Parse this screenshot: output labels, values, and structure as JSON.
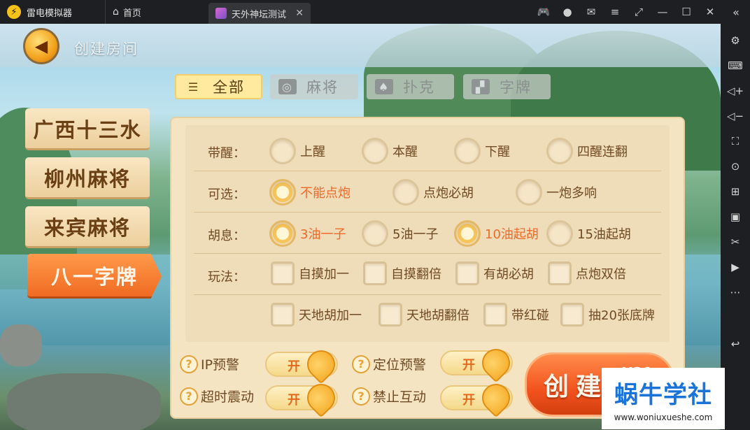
{
  "titlebar": {
    "app_name": "雷电模拟器",
    "tabs": [
      {
        "label": "首页"
      },
      {
        "label": "天外神坛测试"
      }
    ]
  },
  "game": {
    "page_title": "创建房间",
    "categories": [
      {
        "label": "全部",
        "active": true
      },
      {
        "label": "麻将",
        "active": false
      },
      {
        "label": "扑克",
        "active": false
      },
      {
        "label": "字牌",
        "active": false
      }
    ],
    "game_list": [
      {
        "label": "广西十三水"
      },
      {
        "label": "柳州麻将"
      },
      {
        "label": "来宾麻将"
      },
      {
        "label": "八一字牌",
        "active": true
      }
    ],
    "rules": [
      {
        "label": "带醒：",
        "type": "radio",
        "options": [
          {
            "label": "上醒",
            "selected": false
          },
          {
            "label": "本醒",
            "selected": false
          },
          {
            "label": "下醒",
            "selected": false
          },
          {
            "label": "四醒连翻",
            "selected": false
          }
        ]
      },
      {
        "label": "可选：",
        "type": "radio",
        "options": [
          {
            "label": "不能点炮",
            "selected": true
          },
          {
            "label": "点炮必胡",
            "selected": false
          },
          {
            "label": "一炮多响",
            "selected": false
          }
        ]
      },
      {
        "label": "胡息：",
        "type": "radio",
        "options": [
          {
            "label": "3油一子",
            "selected": true
          },
          {
            "label": "5油一子",
            "selected": false
          },
          {
            "label": "10油起胡",
            "selected": true
          },
          {
            "label": "15油起胡",
            "selected": false
          }
        ]
      },
      {
        "label": "玩法：",
        "type": "checkbox",
        "options": [
          {
            "label": "自摸加一",
            "checked": false
          },
          {
            "label": "自摸翻倍",
            "checked": false
          },
          {
            "label": "有胡必胡",
            "checked": false
          },
          {
            "label": "点炮双倍",
            "checked": false
          }
        ]
      },
      {
        "label": "",
        "type": "checkbox",
        "options": [
          {
            "label": "天地胡加一",
            "checked": false
          },
          {
            "label": "天地胡翻倍",
            "checked": false
          },
          {
            "label": "带红碰",
            "checked": false
          },
          {
            "label": "抽20张底牌",
            "checked": false
          }
        ]
      }
    ],
    "toggles": [
      {
        "label": "IP预警",
        "state": "开"
      },
      {
        "label": "定位预警",
        "state": "开"
      },
      {
        "label": "超时震动",
        "state": "开"
      },
      {
        "label": "禁止互动",
        "state": "开"
      }
    ],
    "create_button": {
      "label": "创建",
      "cost": "X20"
    }
  },
  "watermark": {
    "title": "蜗牛学社",
    "url": "www.woniuxueshe.com"
  },
  "colors": {
    "accent": "#f06a23",
    "selected_text": "#ef6a2a",
    "label_text": "#6f4a24",
    "watermark_blue": "#1a73d9"
  }
}
